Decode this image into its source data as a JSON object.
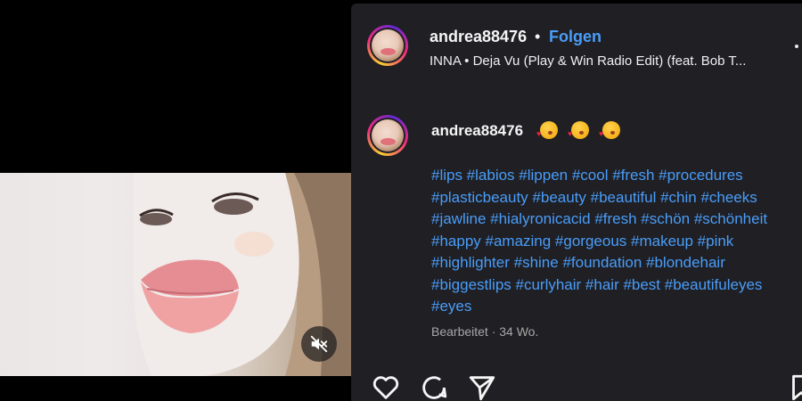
{
  "post": {
    "username": "andrea88476",
    "separator": "•",
    "follow_label": "Folgen",
    "audio": "INNA • Deja Vu (Play & Win Radio Edit) (feat. Bob T..."
  },
  "caption": {
    "username": "andrea88476",
    "hashtag_lines": [
      "#lips #labios #lippen #cool #fresh #procedures",
      "#plasticbeauty #beauty #beautiful #chin #cheeks",
      "#jawline #hialyronicacid #fresh #schön #schönheit",
      "#happy #amazing #gorgeous #makeup #pink",
      "#highlighter #shine #foundation #blondehair",
      "#biggestlips #curlyhair #hair #best #beautifuleyes",
      "#eyes"
    ],
    "edited": "Bearbeitet · 34 Wo."
  },
  "icons": {
    "mute": "muted-speaker-icon",
    "like": "heart-icon",
    "comment": "comment-icon",
    "share": "paper-plane-icon",
    "save": "bookmark-icon",
    "more": "more-options-icon"
  },
  "colors": {
    "panel_bg": "#1f1f24",
    "link": "#4a9df8",
    "text": "#f5f5f5",
    "muted": "#a8a8a8"
  }
}
